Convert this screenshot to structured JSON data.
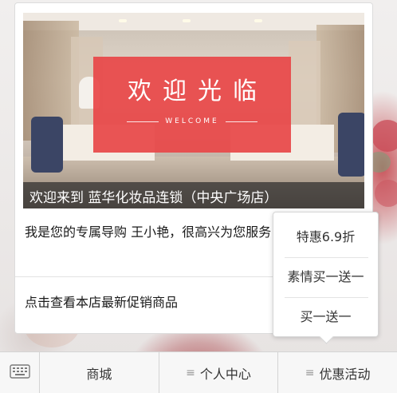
{
  "banner": {
    "welcome_title": "欢迎光临",
    "welcome_sub": "WELCOME",
    "caption": "欢迎来到 蓝华化妆品连锁（中央广场店）"
  },
  "message": {
    "intro": "我是您的专属导购 王小艳，很高兴为您服务！",
    "promo_link": "点击查看本店最新促销商品"
  },
  "popup_menu": {
    "items": [
      "特惠6.9折",
      "素情买一送一",
      "买一送一"
    ]
  },
  "bottom_bar": {
    "keyboard_icon": "keyboard-icon",
    "menu_icon": "hamburger-icon",
    "items": [
      "商城",
      "个人中心",
      "优惠活动"
    ]
  },
  "colors": {
    "welcome_red": "#e84648",
    "caption_bg": "#2d2d2d"
  }
}
